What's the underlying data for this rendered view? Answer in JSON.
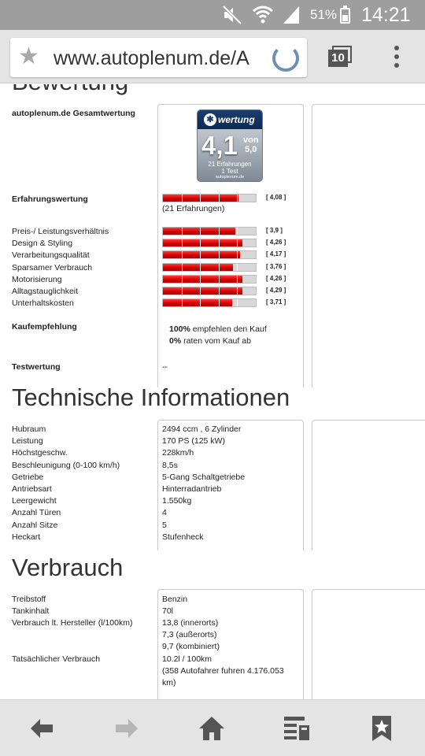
{
  "status_bar": {
    "battery": "51%",
    "time": "14:21"
  },
  "browser": {
    "url": "www.autoplenum.de/A",
    "tab_count": "10"
  },
  "bewertung": {
    "heading": "Bewertung",
    "gesamt_label": "autoplenum.de Gesamtwertung",
    "badge": {
      "brand": "wertung",
      "score": "4,1",
      "von": "von",
      "max": "5,0",
      "experiences": "21 Erfahrungen",
      "tests": "1 Test",
      "site": "autoplenum.de"
    },
    "erfahrung": {
      "label": "Erfahrungswertung",
      "value": 4.08,
      "value_text": "[ 4,08 ]",
      "count_text": "(21 Erfahrungen)"
    },
    "criteria": [
      {
        "label": "Preis-/ Leistungsverhältnis",
        "value": 3.9,
        "value_text": "[ 3,9 ]"
      },
      {
        "label": "Design & Styling",
        "value": 4.26,
        "value_text": "[ 4,26 ]"
      },
      {
        "label": "Verarbeitungsqualität",
        "value": 4.17,
        "value_text": "[ 4,17 ]"
      },
      {
        "label": "Sparsamer Verbrauch",
        "value": 3.76,
        "value_text": "[ 3,76 ]"
      },
      {
        "label": "Motorisierung",
        "value": 4.26,
        "value_text": "[ 4,26 ]"
      },
      {
        "label": "Alltagstauglichkeit",
        "value": 4.29,
        "value_text": "[ 4,29 ]"
      },
      {
        "label": "Unterhaltskosten",
        "value": 3.71,
        "value_text": "[ 3,71 ]"
      }
    ],
    "scale_max": 5,
    "kauf": {
      "label": "Kaufempfehlung",
      "pos_pct": "100%",
      "pos_text": " empfehlen den Kauf",
      "neg_pct": "0%",
      "neg_text": " raten vom Kauf ab"
    },
    "test": {
      "label": "Testwertung",
      "value": "--"
    }
  },
  "technik": {
    "heading": "Technische Informationen",
    "rows": [
      {
        "label": "Hubraum",
        "value": "2494 ccm , 6 Zylinder"
      },
      {
        "label": "Leistung",
        "value": "170 PS (125 kW)"
      },
      {
        "label": "Höchstgeschw.",
        "value": "228km/h"
      },
      {
        "label": "Beschleunigung (0-100 km/h)",
        "value": "8,5s"
      },
      {
        "label": "Getriebe",
        "value": "5-Gang Schaltgetriebe"
      },
      {
        "label": "Antriebsart",
        "value": "Hinterradantrieb"
      },
      {
        "label": "Leergewicht",
        "value": "1.550kg"
      },
      {
        "label": "Anzahl Türen",
        "value": "4"
      },
      {
        "label": "Anzahl Sitze",
        "value": "5"
      },
      {
        "label": "Heckart",
        "value": "Stufenheck"
      }
    ]
  },
  "verbrauch": {
    "heading": "Verbrauch",
    "treibstoff": {
      "label": "Treibstoff",
      "value": "Benzin"
    },
    "tank": {
      "label": "Tankinhalt",
      "value": "70l"
    },
    "hersteller": {
      "label": "Verbrauch lt. Hersteller (l/100km)",
      "lines": [
        "13,8 (innerorts)",
        "7,3 (außerorts)",
        "9,7 (kombiniert)"
      ]
    },
    "tatsaechlich": {
      "label": "Tatsächlicher Verbrauch",
      "lines": [
        "10.2l / 100km",
        "(358 Autofahrer fuhren 4.176.053",
        "km)"
      ]
    }
  },
  "colors": {
    "bar_fill": "#d40000",
    "status_bar": "#9e9e9e",
    "chrome": "#e4e4e4"
  },
  "icons": [
    "wifi-mute-icon",
    "wifi-icon",
    "signal-icon",
    "battery-icon",
    "star-icon",
    "reload-icon",
    "tabs-icon",
    "menu-icon",
    "back-arrow-icon",
    "forward-arrow-icon",
    "home-icon",
    "reading-list-icon",
    "bookmarks-icon"
  ]
}
